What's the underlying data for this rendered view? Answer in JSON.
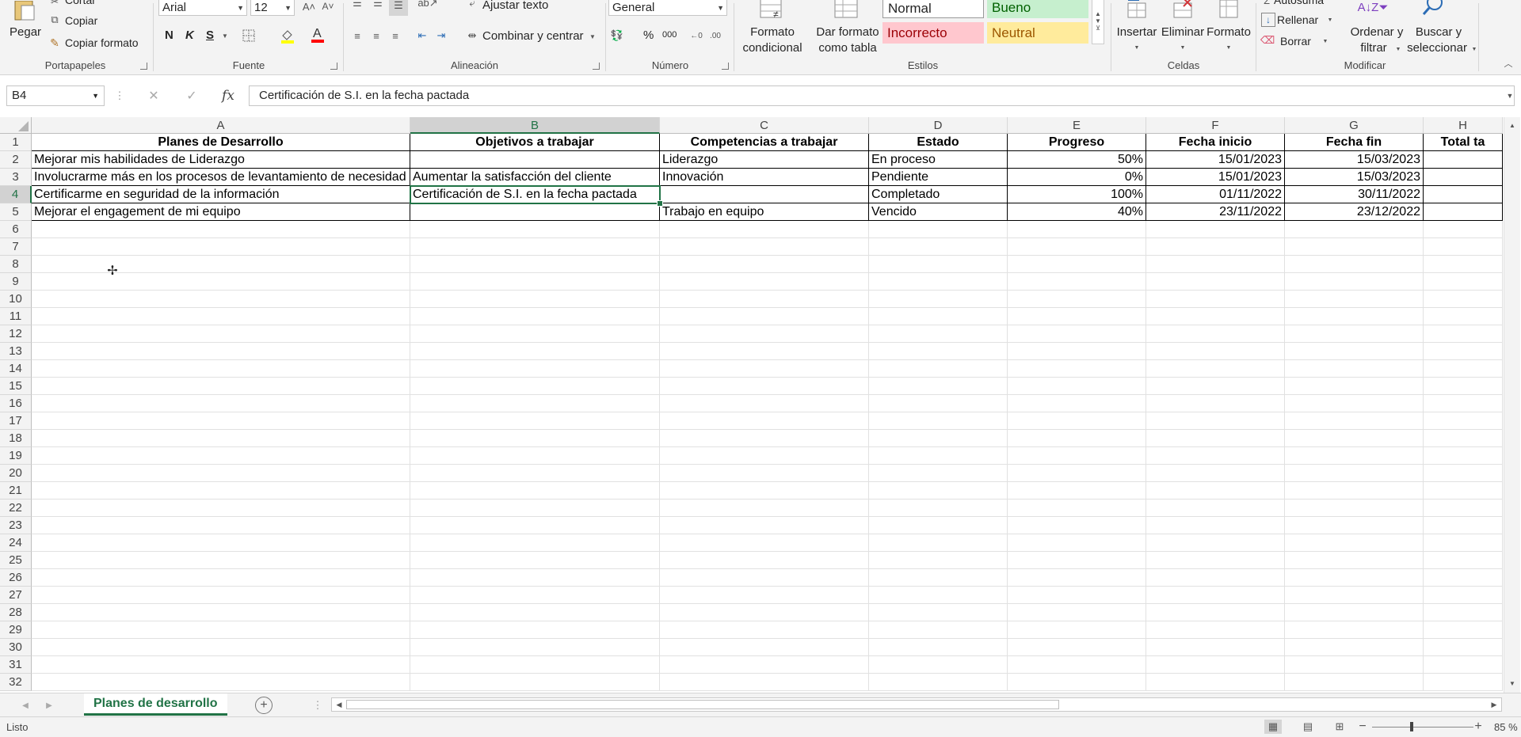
{
  "ribbon": {
    "clipboard": {
      "paste": "Pegar",
      "cut": "Cortar",
      "copy": "Copiar",
      "copy_format": "Copiar formato",
      "group": "Portapapeles"
    },
    "font": {
      "family": "Arial",
      "size": "12",
      "bold": "N",
      "italic": "K",
      "underline": "S",
      "group": "Fuente"
    },
    "alignment": {
      "wrap": "Ajustar texto",
      "merge": "Combinar y centrar",
      "group": "Alineación"
    },
    "number": {
      "format": "General",
      "percent": "%",
      "thousands": "000",
      "group": "Número"
    },
    "styles": {
      "conditional_1": "Formato",
      "conditional_2": "condicional",
      "table_1": "Dar formato",
      "table_2": "como tabla",
      "normal": "Normal",
      "bueno": "Bueno",
      "incorrecto": "Incorrecto",
      "neutral": "Neutral",
      "group": "Estilos",
      "colors": {
        "normal_bg": "#ffffff",
        "bueno_bg": "#c6efce",
        "bueno_fg": "#006100",
        "incorrecto_bg": "#ffc7ce",
        "incorrecto_fg": "#9c0006",
        "neutral_bg": "#ffeb9c",
        "neutral_fg": "#9c5700"
      }
    },
    "cells": {
      "insert": "Insertar",
      "delete": "Eliminar",
      "format": "Formato",
      "group": "Celdas"
    },
    "modify": {
      "autosum": "Autosuma",
      "fill": "Rellenar",
      "clear": "Borrar",
      "sort_1": "Ordenar y",
      "sort_2": "filtrar",
      "find_1": "Buscar y",
      "find_2": "seleccionar",
      "group": "Modificar"
    }
  },
  "formula_bar": {
    "name_box": "B4",
    "cancel": "✕",
    "enter": "✓",
    "fx": "fx",
    "content": "Certificación de S.I. en la fecha pactada"
  },
  "columns": [
    "A",
    "B",
    "C",
    "D",
    "E",
    "F",
    "G",
    "H"
  ],
  "selected_cell": "B4",
  "headers": [
    "Planes de Desarrollo",
    "Objetivos a trabajar",
    "Competencias a trabajar",
    "Estado",
    "Progreso",
    "Fecha inicio",
    "Fecha fin",
    "Total ta"
  ],
  "rows": [
    [
      "Mejorar mis habilidades de Liderazgo",
      "",
      "Liderazgo",
      "En proceso",
      "50%",
      "15/01/2023",
      "15/03/2023",
      ""
    ],
    [
      "Involucrarme más en los procesos de levantamiento de necesidad",
      "Aumentar la satisfacción del cliente",
      "Innovación",
      "Pendiente",
      "0%",
      "15/01/2023",
      "15/03/2023",
      ""
    ],
    [
      "Certificarme en seguridad de la información",
      "Certificación de S.I. en la fecha pactada",
      "",
      "Completado",
      "100%",
      "01/11/2022",
      "30/11/2022",
      ""
    ],
    [
      "Mejorar el engagement de mi equipo",
      "",
      "Trabajo en equipo",
      "Vencido",
      "40%",
      "23/11/2022",
      "23/12/2022",
      ""
    ]
  ],
  "row_numbers": [
    "1",
    "2",
    "3",
    "4",
    "5",
    "6",
    "7",
    "8",
    "9",
    "10",
    "11",
    "12",
    "13",
    "14",
    "15",
    "16",
    "17",
    "18",
    "19",
    "20",
    "21",
    "22",
    "23",
    "24",
    "25",
    "26",
    "27",
    "28",
    "29",
    "30",
    "31",
    "32"
  ],
  "sheet_tab": "Planes de desarrollo",
  "status": {
    "text": "Listo",
    "zoom": "85 %"
  },
  "accent": "#217346"
}
